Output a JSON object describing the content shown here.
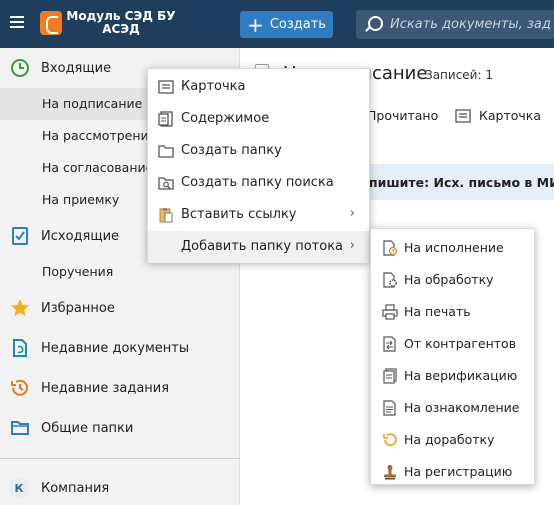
{
  "app": {
    "title_line1": "Модуль СЭД БУ",
    "title_line2": "АСЭД",
    "create_label": "Создать",
    "search_placeholder": "Искать документы, зад"
  },
  "sidebar": {
    "inbox_label": "Входящие",
    "inbox_items": [
      "На подписание",
      "На рассмотрение",
      "На согласование",
      "На приемку"
    ],
    "outgoing_label": "Исходящие",
    "outgoing_items": [
      "Поручения"
    ],
    "favorites_label": "Избранное",
    "recent_docs_label": "Недавние документы",
    "recent_tasks_label": "Недавние задания",
    "shared_folders_label": "Общие папки",
    "company_label": "Компания",
    "company_letter": "К"
  },
  "main": {
    "title": "На подписание",
    "records_label": "Записей: 1",
    "toolbar_read": "Прочитано",
    "toolbar_card": "Карточка",
    "banner_text": "пишите: Исх. письмо в МИ"
  },
  "context_menu": {
    "card": "Карточка",
    "contents": "Содержимое",
    "create_folder": "Создать папку",
    "create_search_folder": "Создать папку поиска",
    "paste_link": "Вставить ссылку",
    "add_flow_folder": "Добавить папку потока"
  },
  "submenu": {
    "items": [
      "На исполнение",
      "На обработку",
      "На печать",
      "От контрагентов",
      "На верификацию",
      "На ознакомление",
      "На доработку",
      "На регистрацию"
    ]
  },
  "colors": {
    "topbar": "#1f3e5e",
    "accent": "#2f7cc1",
    "logo": "#f47b20",
    "inbox_green": "#3c9b3c",
    "star": "#f2b01e",
    "teal": "#1a8fa0"
  }
}
